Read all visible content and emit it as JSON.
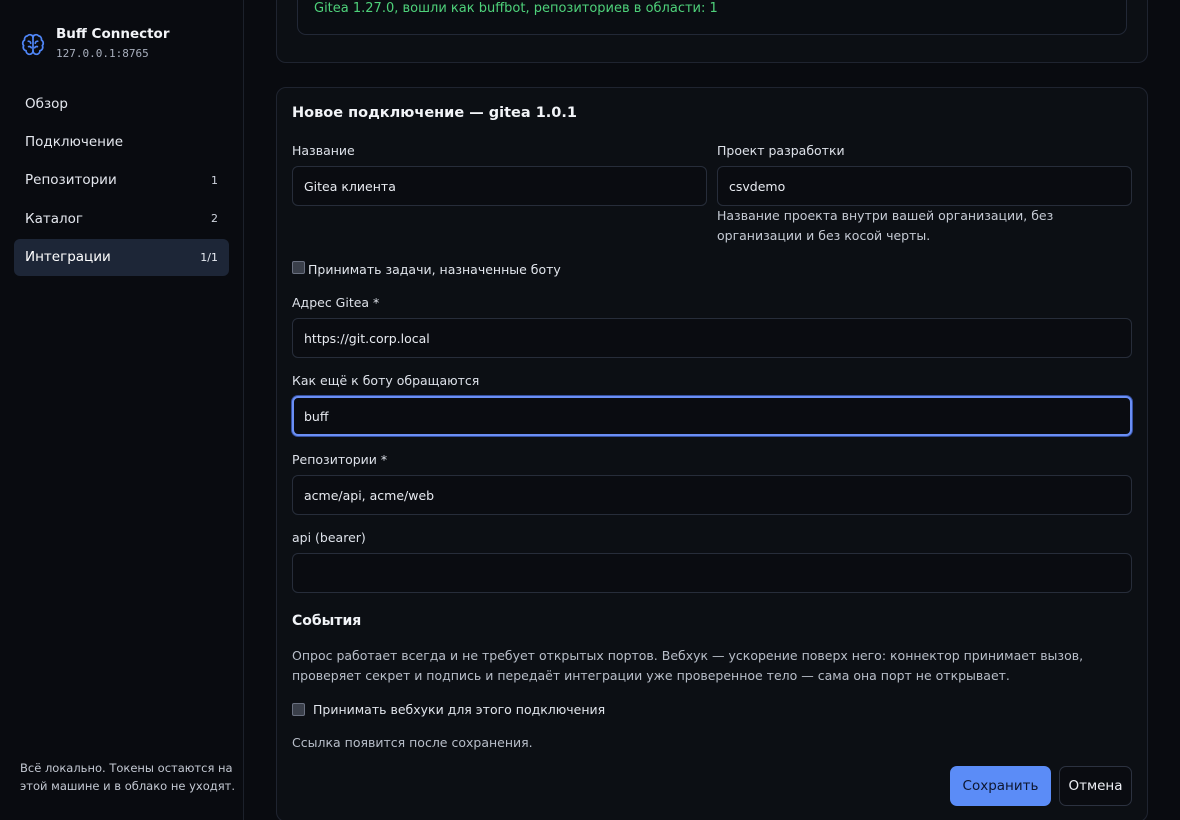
{
  "brand": {
    "name": "Buff Connector",
    "address": "127.0.0.1:8765",
    "icon": "brain-icon"
  },
  "nav": {
    "items": [
      {
        "label": "Обзор",
        "count": ""
      },
      {
        "label": "Подключение",
        "count": ""
      },
      {
        "label": "Репозитории",
        "count": "1"
      },
      {
        "label": "Каталог",
        "count": "2"
      },
      {
        "label": "Интеграции",
        "count": "1/1"
      }
    ],
    "active": "Интеграции"
  },
  "sidebar_footer": "Всё локально. Токены остаются на этой машине и в облако не уходят.",
  "status": {
    "text": "Gitea 1.27.0, вошли как buffbot, репозиториев в области: 1"
  },
  "form": {
    "title": "Новое подключение — gitea 1.0.1",
    "name_label": "Название",
    "name_value": "Gitea клиента",
    "project_label": "Проект разработки",
    "project_value": "csvdemo",
    "project_hint": "Название проекта внутри вашей организации, без организации и без косой черты.",
    "accept_tasks_label": "Принимать задачи, назначенные боту",
    "url_label": "Адрес Gitea *",
    "url_value": "https://git.corp.local",
    "alias_label": "Как ещё к боту обращаются",
    "alias_value": "buff",
    "repos_label": "Репозитории *",
    "repos_value": "acme/api, acme/web",
    "token_label": "api (bearer)",
    "token_value": ""
  },
  "events": {
    "title": "События",
    "description": "Опрос работает всегда и не требует открытых портов. Вебхук — ускорение поверх него: коннектор принимает вызов, проверяет секрет и подпись и передаёт интеграции уже проверенное тело — сама она порт не открывает.",
    "webhook_label": "Принимать вебхуки для этого подключения",
    "link_note": "Ссылка появится после сохранения."
  },
  "actions": {
    "save": "Сохранить",
    "cancel": "Отмена"
  },
  "colors": {
    "accent": "#5b8cf7",
    "status_ok": "#4ed17a",
    "active_nav": "#1d2637"
  }
}
